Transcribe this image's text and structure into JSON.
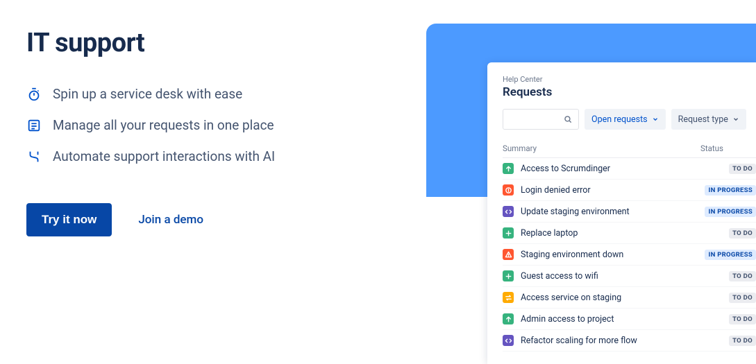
{
  "hero": {
    "title": "IT support",
    "features": [
      {
        "icon": "stopwatch",
        "text": "Spin up a service desk with ease"
      },
      {
        "icon": "requests",
        "text": "Manage all your requests in one place"
      },
      {
        "icon": "automate",
        "text": "Automate support interactions with AI"
      }
    ],
    "cta_primary": "Try it now",
    "cta_secondary": "Join a demo"
  },
  "preview": {
    "breadcrumb": "Help Center",
    "title": "Requests",
    "filter_open": "Open requests",
    "filter_type": "Request type",
    "columns": {
      "summary": "Summary",
      "status": "Status"
    },
    "status_labels": {
      "todo": "TO DO",
      "in_progress": "IN PROGRESS"
    },
    "rows": [
      {
        "icon": "arrow-up",
        "color": "#36b37e",
        "summary": "Access to Scrumdinger",
        "status": "todo"
      },
      {
        "icon": "error",
        "color": "#ff5630",
        "summary": "Login denied error",
        "status": "in_progress"
      },
      {
        "icon": "code",
        "color": "#6554c0",
        "summary": "Update staging environment",
        "status": "in_progress"
      },
      {
        "icon": "plus",
        "color": "#36b37e",
        "summary": "Replace laptop",
        "status": "todo"
      },
      {
        "icon": "alert",
        "color": "#ff5630",
        "summary": "Staging environment down",
        "status": "in_progress"
      },
      {
        "icon": "plus",
        "color": "#36b37e",
        "summary": "Guest access to wifi",
        "status": "todo"
      },
      {
        "icon": "swap",
        "color": "#ffab00",
        "summary": "Access service on staging",
        "status": "todo"
      },
      {
        "icon": "arrow-up",
        "color": "#36b37e",
        "summary": "Admin access to project",
        "status": "todo"
      },
      {
        "icon": "code",
        "color": "#6554c0",
        "summary": "Refactor scaling for more flow",
        "status": "todo"
      }
    ]
  }
}
